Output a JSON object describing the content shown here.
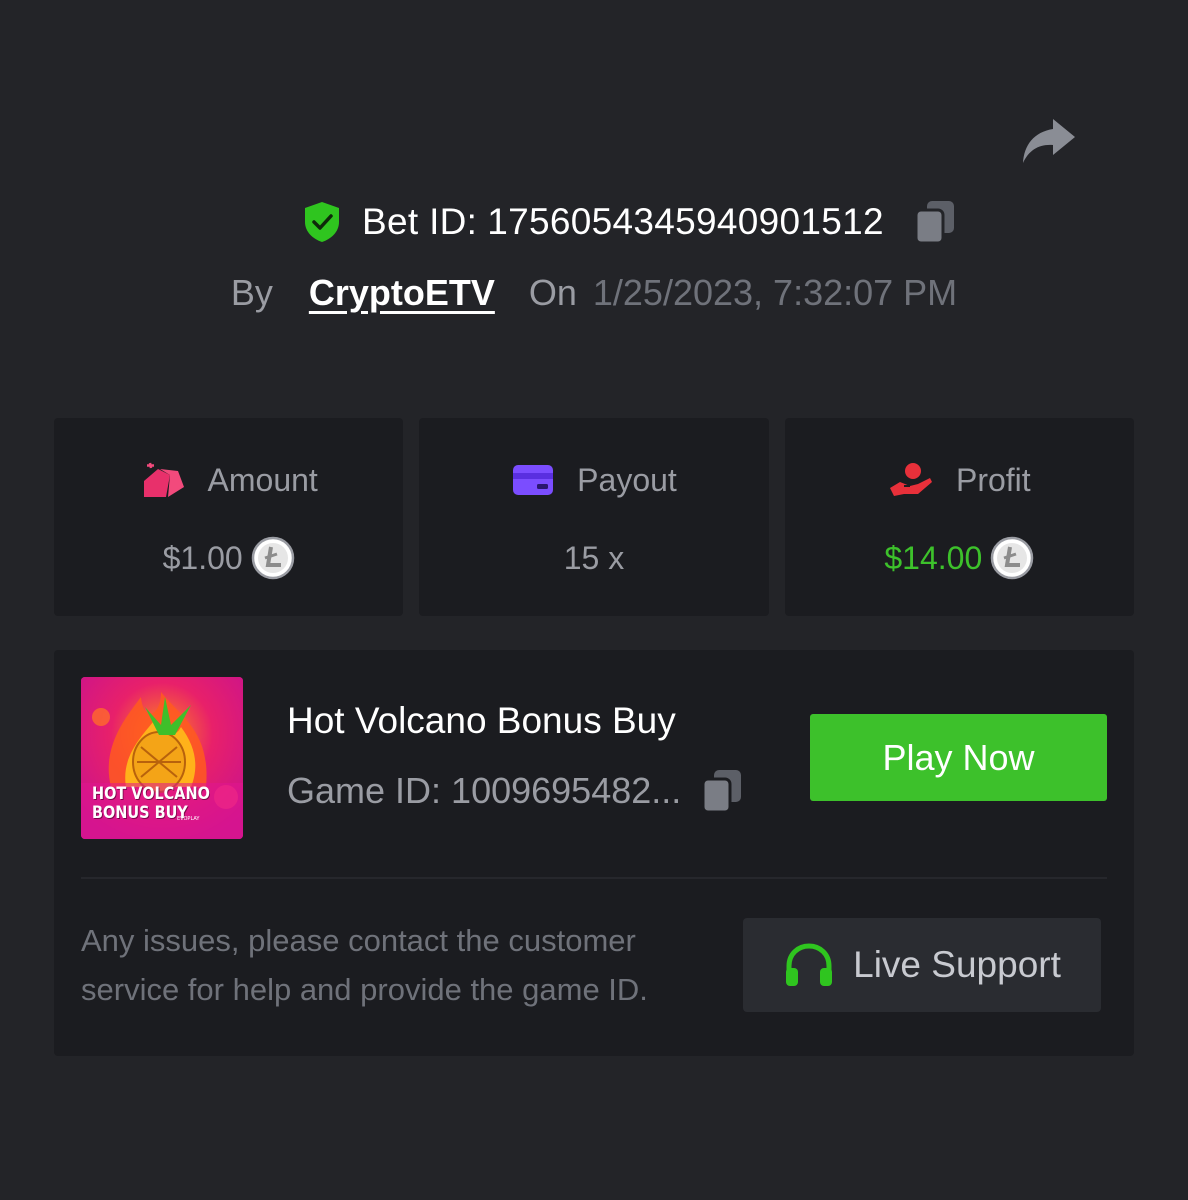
{
  "header": {
    "share_icon": "share-icon",
    "bet_id_label": "Bet ID:",
    "bet_id": "1756054345940901512",
    "verified_icon": "shield-check-icon",
    "by_label": "By",
    "username": "CryptoETV",
    "on_label": "On",
    "datetime": "1/25/2023, 7:32:07 PM"
  },
  "stats": {
    "amount": {
      "label": "Amount",
      "value": "$1.00",
      "icon": "money-bag-icon",
      "coin": "litecoin-icon"
    },
    "payout": {
      "label": "Payout",
      "value": "15 x",
      "icon": "card-icon"
    },
    "profit": {
      "label": "Profit",
      "value": "$14.00",
      "icon": "hand-user-icon",
      "coin": "litecoin-icon"
    }
  },
  "game": {
    "thumbnail_title_line1": "HOT VOLCANO",
    "thumbnail_title_line2": "BONUS BUY",
    "thumbnail_brand": "EVOPLAY",
    "title": "Hot Volcano Bonus Buy",
    "game_id_label": "Game ID:",
    "game_id": "1009695482...",
    "play_button": "Play Now"
  },
  "support": {
    "help_text": "Any issues, please contact the customer service for help and provide the game ID.",
    "button_label": "Live Support",
    "icon": "headphones-icon"
  },
  "colors": {
    "background": "#232428",
    "card": "#1b1c20",
    "accent_green": "#3dc12b",
    "amount_icon": "#e8306b",
    "payout_icon": "#7b4dff",
    "profit_icon": "#e8303a"
  }
}
